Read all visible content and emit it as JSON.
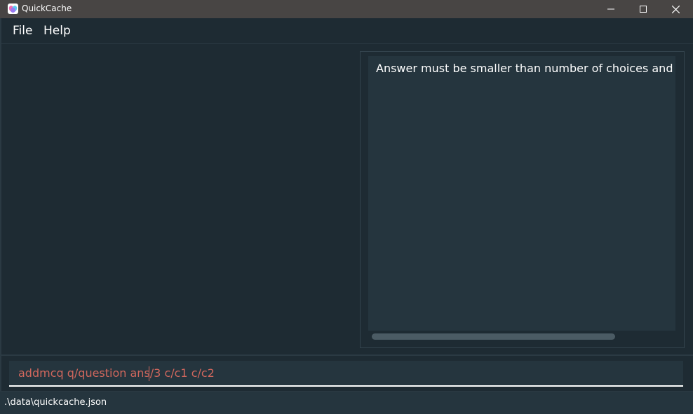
{
  "window": {
    "title": "QuickCache",
    "icons": {
      "app": "quickcache-logo-icon",
      "minimize": "minimize-icon",
      "maximize": "maximize-icon",
      "close": "close-icon"
    }
  },
  "menu": {
    "items": [
      {
        "label": "File"
      },
      {
        "label": "Help"
      }
    ]
  },
  "result_display": {
    "text": "Answer must be smaller than number of choices and should be a positive integer"
  },
  "command_box": {
    "value": "addmcq q/question ans/3 c/c1 c/c2",
    "text_color": "#d0675d"
  },
  "status_bar": {
    "path": ".\\data\\quickcache.json"
  },
  "colors": {
    "background": "#1e2b33",
    "panel": "#25353e",
    "titlebar": "#484544",
    "error_text": "#d0675d"
  }
}
